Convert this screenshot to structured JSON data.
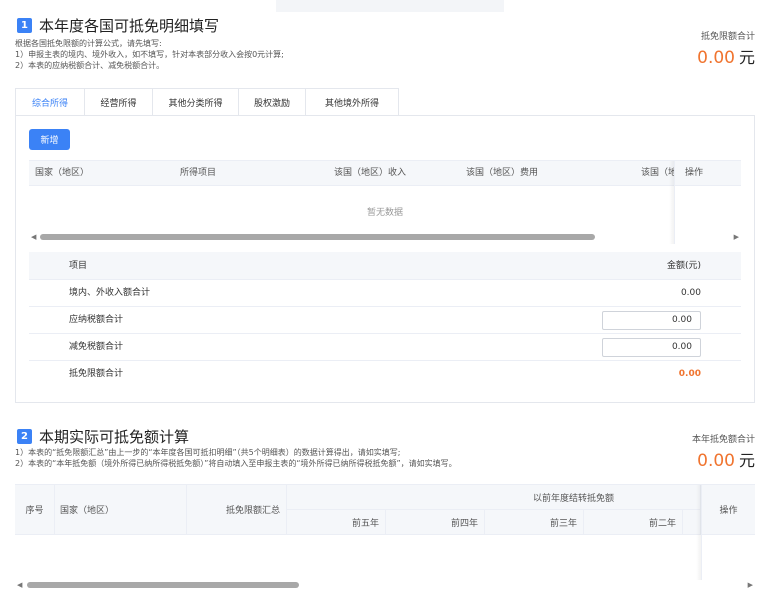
{
  "section1": {
    "number": "1",
    "title": "本年度各国可抵免明细填写",
    "desc": [
      "根据各国抵免限额的计算公式，请先填写:",
      "1）申报主表的境内、境外收入，如不填写，针对本表部分收入会按0元计算;",
      "2）本表的应纳税额合计、减免税额合计。"
    ],
    "total_label": "抵免限额合计",
    "total_value": "0.00",
    "total_unit": "元"
  },
  "tabs": [
    "综合所得",
    "经营所得",
    "其他分类所得",
    "股权激励",
    "其他境外所得"
  ],
  "active_tab": 0,
  "add_button": "新增",
  "table1": {
    "columns": [
      "国家（地区）",
      "所得项目",
      "该国（地区）收入",
      "该国（地区）费用",
      "该国（地"
    ],
    "op_column": "操作",
    "empty_text": "暂无数据"
  },
  "summary": {
    "header_label": "项目",
    "header_value": "金额(元)",
    "rows": [
      {
        "label": "境内、外收入额合计",
        "value": "0.00"
      },
      {
        "label": "应纳税额合计",
        "value": "0.00"
      },
      {
        "label": "减免税额合计",
        "value": "0.00"
      },
      {
        "label": "抵免限额合计",
        "value": "0.00"
      }
    ]
  },
  "section2": {
    "number": "2",
    "title": "本期实际可抵免额计算",
    "desc": [
      "1）本表的“抵免限额汇总”由上一步的“本年度各国可抵扣明细”（共5个明细表）的数据计算得出，请如实填写;",
      "2）本表的“本年抵免额（境外所得已纳所得税抵免额）”将自动填入至申报主表的“境外所得已纳所得税抵免额”，请如实填写。"
    ],
    "total_label": "本年抵免额合计",
    "total_value": "0.00",
    "total_unit": "元"
  },
  "table2": {
    "col_index": "序号",
    "col_country": "国家（地区）",
    "col_limit": "抵免限额汇总",
    "group_label": "以前年度结转抵免额",
    "sub_columns": [
      "前五年",
      "前四年",
      "前三年",
      "前二年"
    ],
    "op_column": "操作"
  },
  "colors": {
    "primary": "#3b82f6",
    "accent": "#f0742f"
  }
}
